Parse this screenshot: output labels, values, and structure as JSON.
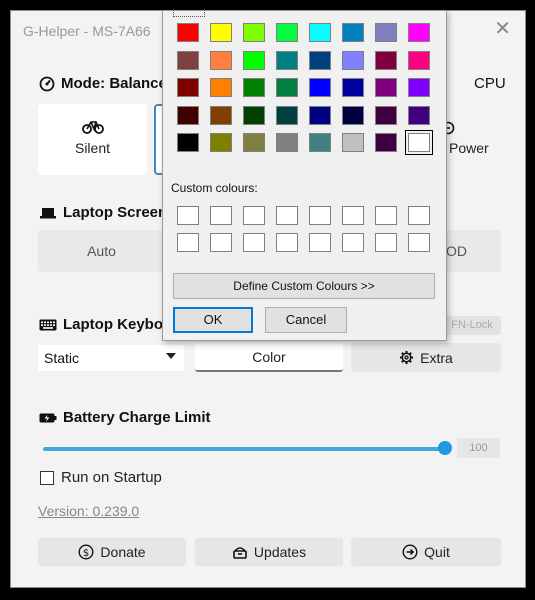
{
  "window": {
    "title": "G-Helper - MS-7A66",
    "close_glyph": "✕"
  },
  "mode": {
    "title": "Mode: Balance",
    "cpu_label": "CPU",
    "cards": [
      {
        "label": "Silent",
        "icon": "bike-icon"
      },
      {
        "label": "Power",
        "icon": "power-icon"
      }
    ]
  },
  "screen": {
    "title": "Laptop Screen",
    "options": [
      "Auto",
      "OD"
    ]
  },
  "keyboard": {
    "title": "Laptop Keyboa",
    "fn_lock": "FN-Lock",
    "mode_value": "Static",
    "color_button": "Color",
    "extra_button": "Extra"
  },
  "battery": {
    "title": "Battery Charge Limit",
    "value": "100",
    "fraction": 1.0
  },
  "startup": {
    "label": "Run on Startup",
    "checked": false
  },
  "version": "Version: 0.239.0",
  "footer": {
    "donate": "Donate",
    "updates": "Updates",
    "quit": "Quit"
  },
  "color_dialog": {
    "basic_colors": [
      [
        "#FF0000",
        "#FFFF00",
        "#80FF00",
        "#00FF40",
        "#00FFFF",
        "#0080C0",
        "#8080C0",
        "#FF00FF"
      ],
      [
        "#804040",
        "#FF8040",
        "#00FF00",
        "#008080",
        "#004080",
        "#8080FF",
        "#800040",
        "#FF0080"
      ],
      [
        "#800000",
        "#FF8000",
        "#008000",
        "#008040",
        "#0000FF",
        "#0000A0",
        "#800080",
        "#8000FF"
      ],
      [
        "#400000",
        "#804000",
        "#004000",
        "#004040",
        "#000080",
        "#000040",
        "#400040",
        "#400080"
      ],
      [
        "#000000",
        "#808000",
        "#808040",
        "#808080",
        "#408080",
        "#C0C0C0",
        "#400040",
        "#FFFFFF"
      ]
    ],
    "selected": [
      4,
      7
    ],
    "custom_label": "Custom colours:",
    "define_button": "Define Custom Colours >>",
    "ok_button": "OK",
    "cancel_button": "Cancel"
  }
}
